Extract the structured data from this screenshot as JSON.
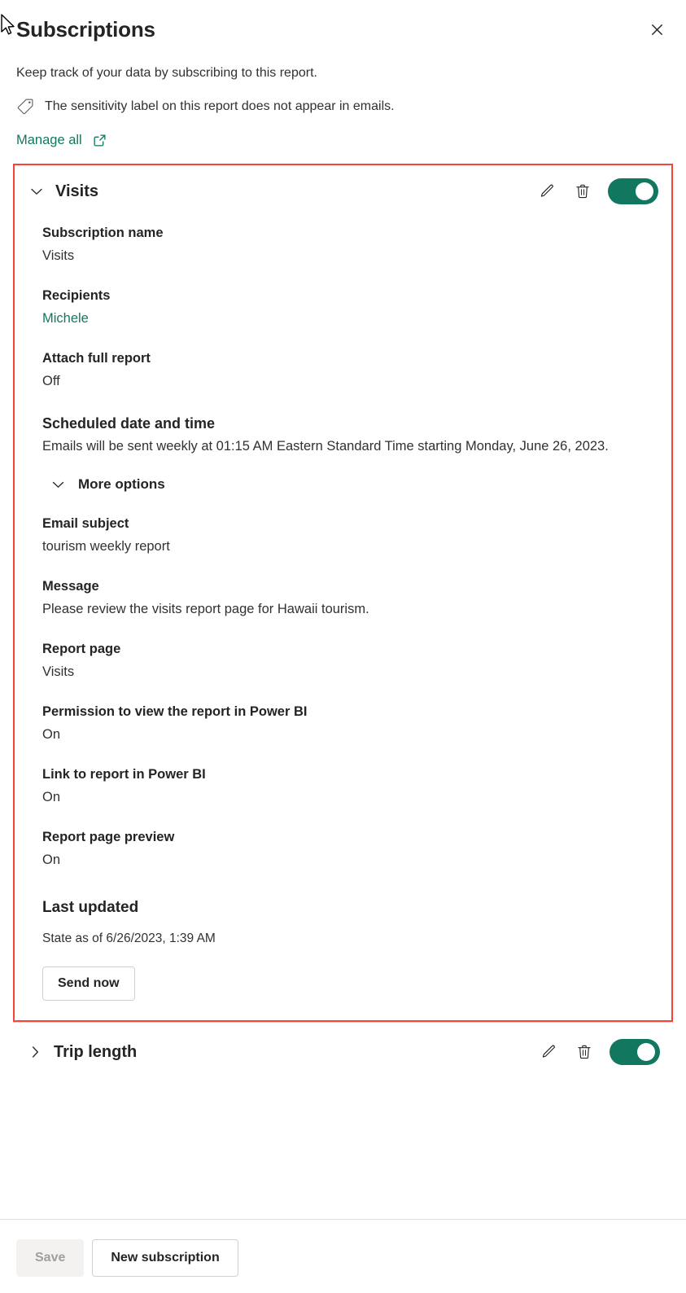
{
  "header": {
    "title": "Subscriptions",
    "close_icon": "close-icon",
    "subtitle": "Keep track of your data by subscribing to this report.",
    "sensitivity_icon": "tag-icon",
    "sensitivity_text": "The sensitivity label on this report does not appear in emails.",
    "manage_all_label": "Manage all",
    "manage_all_icon": "external-link-icon"
  },
  "colors": {
    "accent_teal": "#11785f",
    "highlight_red": "#f9423a",
    "toggle_on": "#11785f",
    "text_primary": "#252423",
    "text_secondary": "#323130",
    "disabled_text": "#a19f9d"
  },
  "subscriptions": [
    {
      "name": "Visits",
      "expanded": true,
      "chevron_icon": "chevron-down-icon",
      "edit_icon": "pencil-icon",
      "delete_icon": "trash-icon",
      "toggle_state": "On",
      "fields": {
        "subscription_name_label": "Subscription name",
        "subscription_name_value": "Visits",
        "recipients_label": "Recipients",
        "recipients_value": "Michele",
        "attach_full_report_label": "Attach full report",
        "attach_full_report_value": "Off",
        "schedule_label": "Scheduled date and time",
        "schedule_value": "Emails will be sent weekly at 01:15 AM Eastern Standard Time starting Monday, June 26, 2023.",
        "more_options_label": "More options",
        "more_options_icon": "chevron-down-icon",
        "email_subject_label": "Email subject",
        "email_subject_value": "tourism weekly report",
        "message_label": "Message",
        "message_value": "Please review the visits report page for Hawaii tourism.",
        "report_page_label": "Report page",
        "report_page_value": "Visits",
        "permission_label": "Permission to view the report in Power BI",
        "permission_value": "On",
        "link_label": "Link to report in Power BI",
        "link_value": "On",
        "preview_label": "Report page preview",
        "preview_value": "On",
        "last_updated_label": "Last updated",
        "last_updated_value": "State as of 6/26/2023, 1:39 AM",
        "send_now_label": "Send now"
      }
    },
    {
      "name": "Trip length",
      "expanded": false,
      "chevron_icon": "chevron-right-icon",
      "edit_icon": "pencil-icon",
      "delete_icon": "trash-icon",
      "toggle_state": "On"
    }
  ],
  "footer": {
    "save_label": "Save",
    "save_disabled": true,
    "new_subscription_label": "New subscription"
  }
}
